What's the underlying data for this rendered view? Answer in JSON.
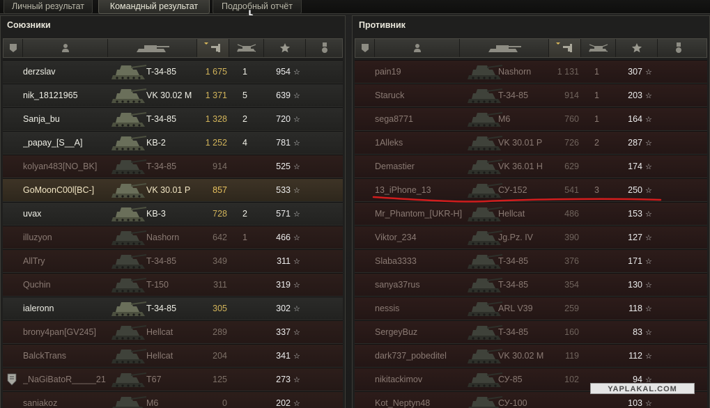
{
  "tabs": [
    "Личный результат",
    "Командный результат",
    "Подробный отчёт"
  ],
  "active_tab": 1,
  "allies": {
    "title": "Союзники",
    "players": [
      {
        "name": "derzslav",
        "tank": "T-34-85",
        "exp": "1 675",
        "kills": "1",
        "pts": "954",
        "state": "alive"
      },
      {
        "name": "nik_18121965",
        "tank": "VK 30.02 M",
        "exp": "1 371",
        "kills": "5",
        "pts": "639",
        "state": "alive"
      },
      {
        "name": "Sanja_bu",
        "tank": "T-34-85",
        "exp": "1 328",
        "kills": "2",
        "pts": "720",
        "state": "alive"
      },
      {
        "name": "_papay_[S__A]",
        "tank": "KB-2",
        "exp": "1 252",
        "kills": "4",
        "pts": "781",
        "state": "alive"
      },
      {
        "name": "kolyan483[NO_BK]",
        "tank": "T-34-85",
        "exp": "914",
        "kills": "",
        "pts": "525",
        "state": "dead"
      },
      {
        "name": "GoMoonC00l[BC-]",
        "tank": "VK 30.01 P",
        "exp": "857",
        "kills": "",
        "pts": "533",
        "state": "self"
      },
      {
        "name": "uvax",
        "tank": "KB-3",
        "exp": "728",
        "kills": "2",
        "pts": "571",
        "state": "alive"
      },
      {
        "name": "illuzyon",
        "tank": "Nashorn",
        "exp": "642",
        "kills": "1",
        "pts": "466",
        "state": "dead"
      },
      {
        "name": "AllTry",
        "tank": "T-34-85",
        "exp": "349",
        "kills": "",
        "pts": "311",
        "state": "dead"
      },
      {
        "name": "Quchin",
        "tank": "T-150",
        "exp": "311",
        "kills": "",
        "pts": "319",
        "state": "dead"
      },
      {
        "name": "ialeronn",
        "tank": "T-34-85",
        "exp": "305",
        "kills": "",
        "pts": "302",
        "state": "alive"
      },
      {
        "name": "brony4pan[GV245]",
        "tank": "Hellcat",
        "exp": "289",
        "kills": "",
        "pts": "337",
        "state": "dead"
      },
      {
        "name": "BalckTrans",
        "tank": "Hellcat",
        "exp": "204",
        "kills": "",
        "pts": "341",
        "state": "dead"
      },
      {
        "name": "_NaGiBatoR_____21",
        "tank": "T67",
        "exp": "125",
        "kills": "",
        "pts": "273",
        "state": "dead",
        "badge": true
      },
      {
        "name": "saniakoz",
        "tank": "M6",
        "exp": "0",
        "kills": "",
        "pts": "202",
        "state": "dead"
      }
    ]
  },
  "enemies": {
    "title": "Противник",
    "players": [
      {
        "name": "pain19",
        "tank": "Nashorn",
        "exp": "1 131",
        "kills": "1",
        "pts": "307",
        "state": "dead"
      },
      {
        "name": "Staruck",
        "tank": "T-34-85",
        "exp": "914",
        "kills": "1",
        "pts": "203",
        "state": "dead"
      },
      {
        "name": "sega8771",
        "tank": "M6",
        "exp": "760",
        "kills": "1",
        "pts": "164",
        "state": "dead"
      },
      {
        "name": "1Alleks",
        "tank": "VK 30.01 P",
        "exp": "726",
        "kills": "2",
        "pts": "287",
        "state": "dead"
      },
      {
        "name": "Demastier",
        "tank": "VK 36.01 H",
        "exp": "629",
        "kills": "",
        "pts": "174",
        "state": "dead"
      },
      {
        "name": "13_iPhone_13",
        "tank": "СУ-152",
        "exp": "541",
        "kills": "3",
        "pts": "250",
        "state": "dead",
        "underline": true
      },
      {
        "name": "Mr_Phantom_[UKR-H]",
        "tank": "Hellcat",
        "exp": "486",
        "kills": "",
        "pts": "153",
        "state": "dead"
      },
      {
        "name": "Viktor_234",
        "tank": "Jg.Pz. IV",
        "exp": "390",
        "kills": "",
        "pts": "127",
        "state": "dead"
      },
      {
        "name": "Slaba3333",
        "tank": "T-34-85",
        "exp": "376",
        "kills": "",
        "pts": "171",
        "state": "dead"
      },
      {
        "name": "sanya37rus",
        "tank": "T-34-85",
        "exp": "354",
        "kills": "",
        "pts": "130",
        "state": "dead"
      },
      {
        "name": "nessis",
        "tank": "ARL V39",
        "exp": "259",
        "kills": "",
        "pts": "118",
        "state": "dead"
      },
      {
        "name": "SergeyBuz",
        "tank": "T-34-85",
        "exp": "160",
        "kills": "",
        "pts": "83",
        "state": "dead"
      },
      {
        "name": "dark737_pobeditel",
        "tank": "VK 30.02 M",
        "exp": "119",
        "kills": "",
        "pts": "112",
        "state": "dead"
      },
      {
        "name": "nikitackimov",
        "tank": "СУ-85",
        "exp": "102",
        "kills": "",
        "pts": "94",
        "state": "dead"
      },
      {
        "name": "Kot_Neptyn48",
        "tank": "СУ-100",
        "exp": "",
        "kills": "",
        "pts": "103",
        "state": "dead"
      }
    ]
  },
  "watermark": "YAPLAKAL.COM",
  "colors": {
    "underline": "#d21d1d",
    "exp_gold": "#d2b45a"
  }
}
